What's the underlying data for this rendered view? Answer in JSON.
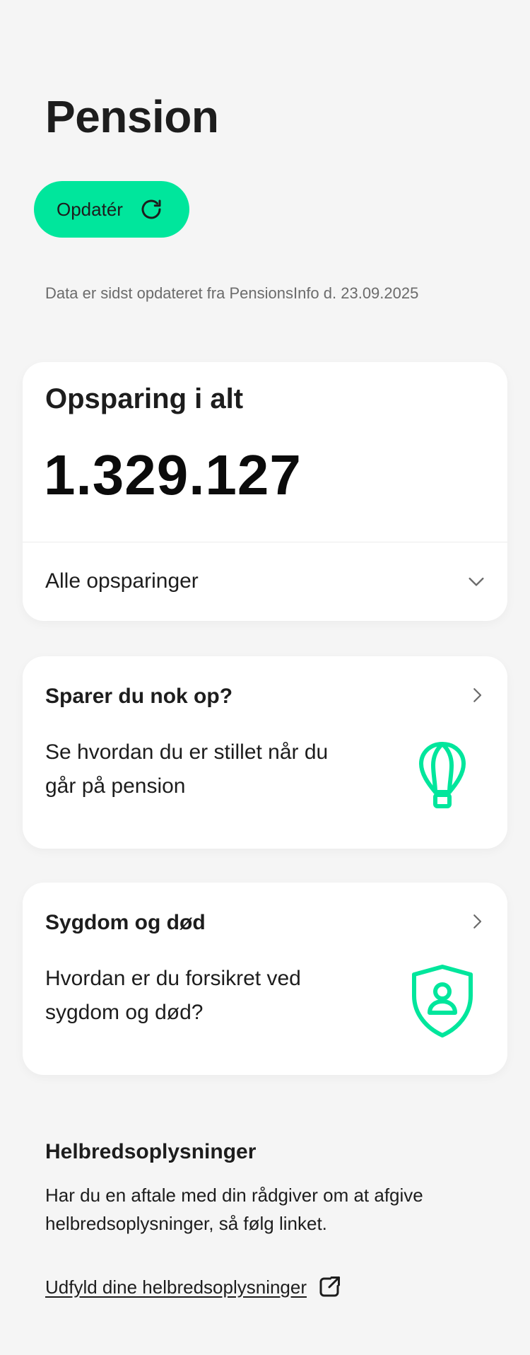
{
  "header": {
    "title": "Pension",
    "update_label": "Opdatér",
    "updated_note": "Data er sidst opdateret fra PensionsInfo d. 23.09.2025"
  },
  "savings": {
    "heading": "Opsparing i alt",
    "total": "1.329.127",
    "dropdown_label": "Alle opsparinger"
  },
  "cards": [
    {
      "title": "Sparer du nok op?",
      "description": "Se hvordan du er stillet når du går på pension",
      "icon": "hot-air-balloon-icon"
    },
    {
      "title": "Sygdom og død",
      "description": "Hvordan er du forsikret ved sygdom og død?",
      "icon": "shield-person-icon"
    }
  ],
  "health": {
    "title": "Helbredsoplysninger",
    "description": "Har du en aftale med din rådgiver om at afgive helbredsoplysninger, så følg linket.",
    "link_label": "Udfyld dine helbredsoplysninger",
    "link_icon": "external-link-icon"
  },
  "colors": {
    "accent": "#00e69c",
    "background": "#f5f5f5",
    "card": "#ffffff",
    "text": "#1d1d1d",
    "muted": "#6b6b6b"
  }
}
